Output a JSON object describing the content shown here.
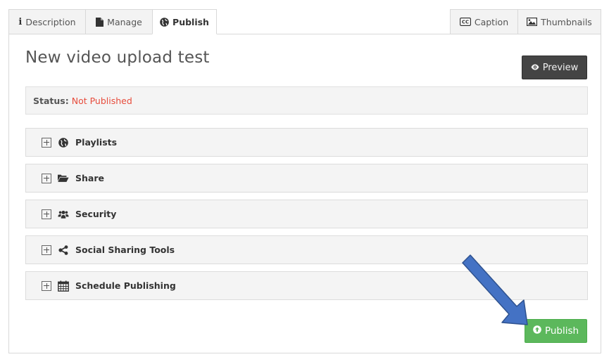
{
  "tabs": [
    {
      "label": "Description",
      "icon": "info-icon"
    },
    {
      "label": "Manage",
      "icon": "file-icon"
    },
    {
      "label": "Publish",
      "icon": "globe-icon",
      "active": true
    },
    {
      "label": "Caption",
      "icon": "cc-icon"
    },
    {
      "label": "Thumbnails",
      "icon": "image-icon"
    }
  ],
  "page": {
    "title": "New video upload test",
    "preview_label": "Preview",
    "publish_label": "Publish"
  },
  "status": {
    "label": "Status:",
    "value": "Not Published",
    "value_color": "#e74c3c"
  },
  "sections": [
    {
      "label": "Playlists",
      "icon": "globe-icon"
    },
    {
      "label": "Share",
      "icon": "folder-open-icon"
    },
    {
      "label": "Security",
      "icon": "users-icon"
    },
    {
      "label": "Social Sharing Tools",
      "icon": "share-nodes-icon"
    },
    {
      "label": "Schedule Publishing",
      "icon": "calendar-icon"
    }
  ],
  "colors": {
    "publish_button": "#5cb85c",
    "preview_button": "#444444",
    "annotation_arrow": "#4472c4"
  }
}
